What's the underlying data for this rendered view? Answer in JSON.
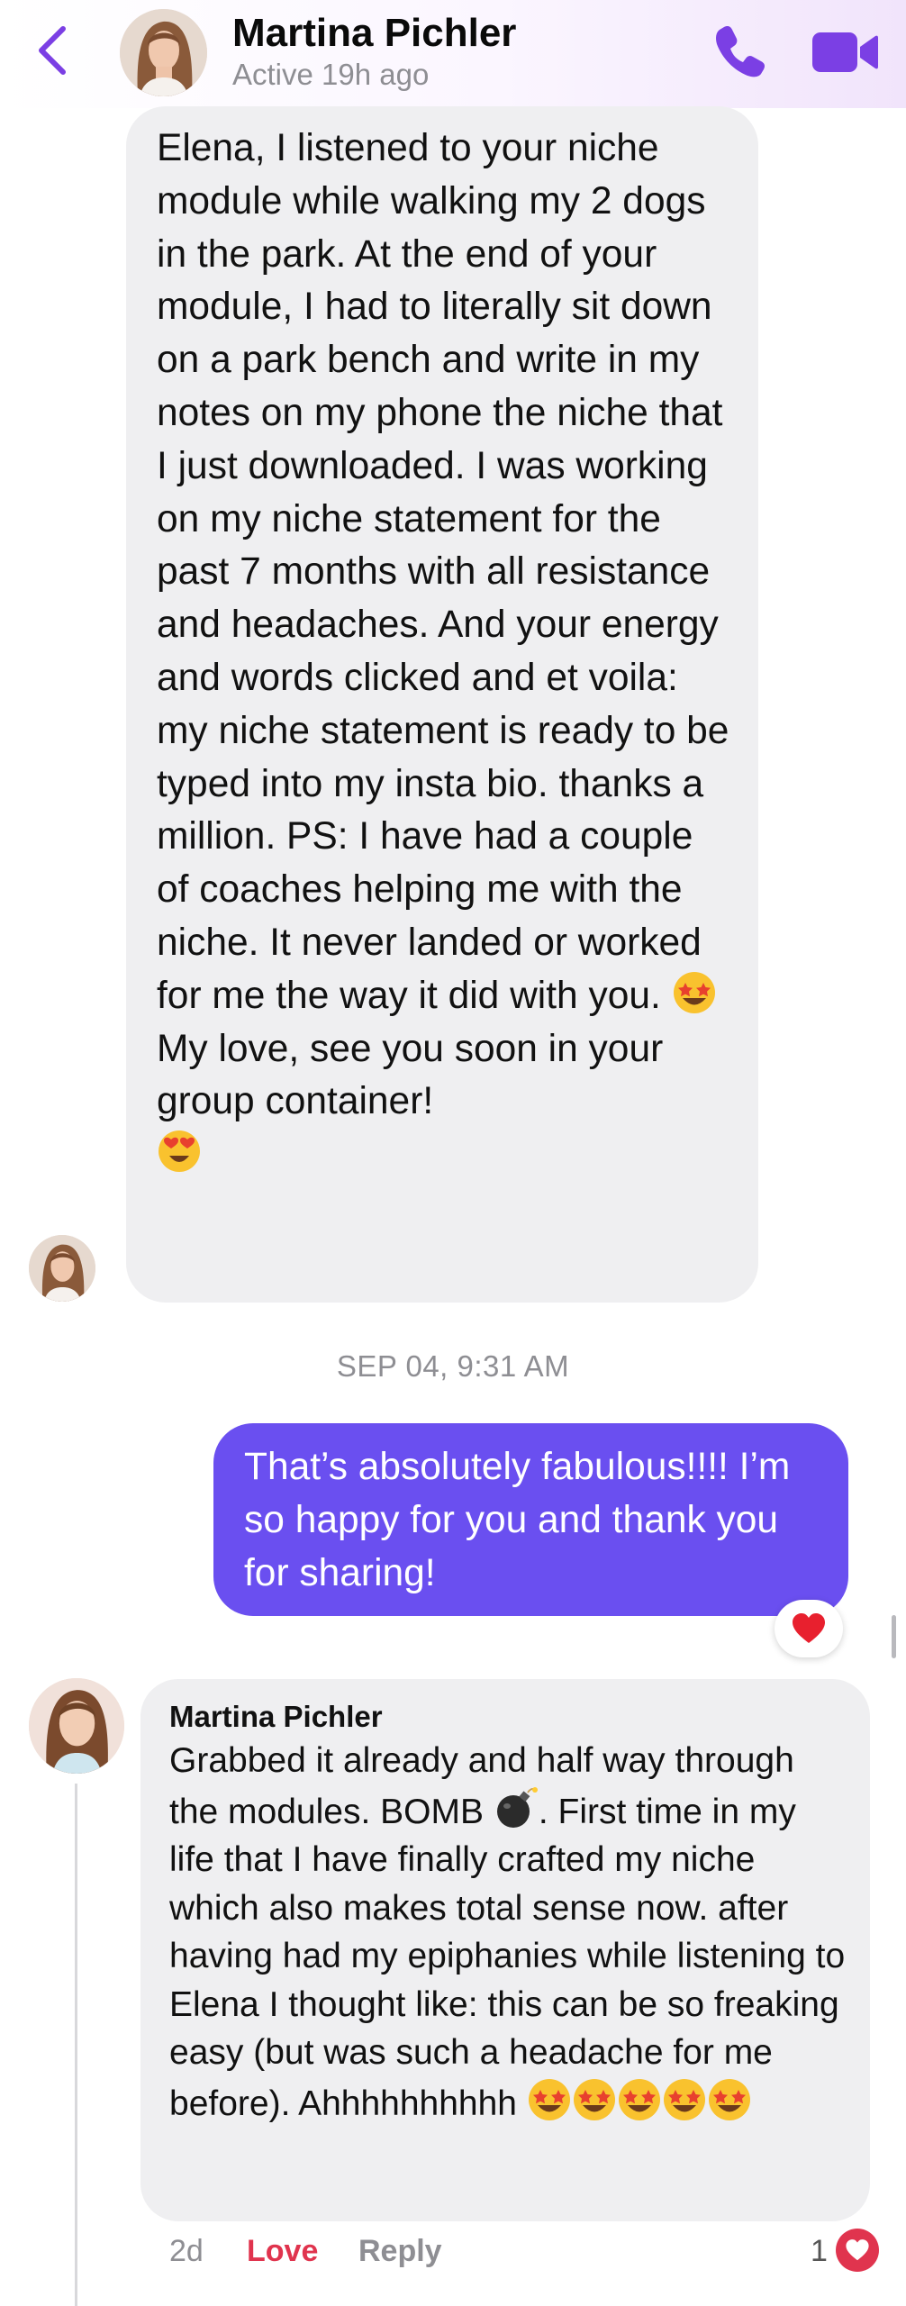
{
  "header": {
    "name": "Martina Pichler",
    "status": "Active 19h ago"
  },
  "messages": [
    {
      "direction": "incoming",
      "text_part1": "Elena, I listened to your niche module while walking my 2 dogs in the park. At the end of your module, I had to literally sit down on a park bench and write in my notes on my phone the niche that I just downloaded. I was working on my niche statement for the past 7 months with all resistance and headaches. And your energy and words clicked and et voila: my niche statement is ready to be typed into my insta bio. thanks a million. PS: I have had a couple of coaches helping me with the niche. It never landed or worked for me the way it did with you.",
      "emoji1": "star-struck-emoji",
      "text_part2": "My love, see you soon in your group container!",
      "emoji2": "heart-eyes-emoji"
    },
    {
      "direction": "timestamp",
      "text": "SEP 04, 9:31 AM"
    },
    {
      "direction": "outgoing",
      "text": "That’s absolutely fabulous!!!! I’m so happy for you and thank you for sharing!",
      "reaction": "red-heart"
    }
  ],
  "comment": {
    "author": "Martina Pichler",
    "text_part1": "Grabbed it already and half way through the modules. BOMB",
    "emoji_bomb": "bomb-emoji",
    "text_part2": ". First time in my life that I have finally crafted my niche which also makes total sense now. after having had my epiphanies while listening to Elena I thought like: this can be so freaking easy (but was such a headache for me before). Ahhhhhhhhhh",
    "trailing_emojis": "star-struck-emoji x5",
    "time": "2d",
    "love_label": "Love",
    "reply_label": "Reply",
    "reaction_count": "1"
  },
  "colors": {
    "accent": "#7b3fe4",
    "outgoing_bubble": "#6a4ff0",
    "incoming_bubble": "#efeff1",
    "love": "#e0344e"
  }
}
